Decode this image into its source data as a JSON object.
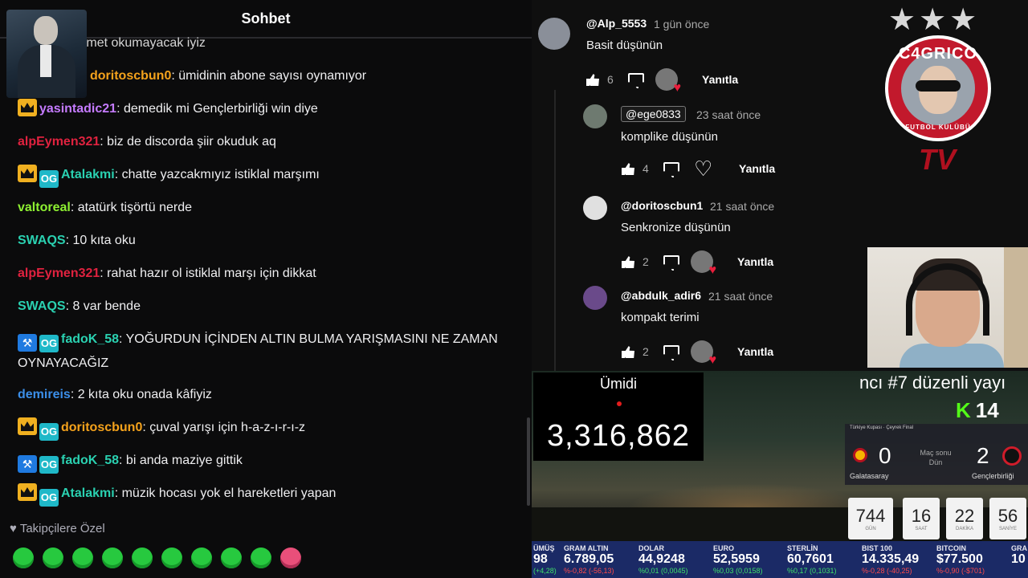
{
  "chat": {
    "title": "Sohbet",
    "messages": [
      {
        "user": "",
        "text": "atatürke rahmet okumayacak iyiz",
        "color": "#d6d6d6"
      },
      {
        "user": "doritoscbun0",
        "text": ": ümidinin abone sayısı oynamıyor",
        "color": "#f4a21c"
      },
      {
        "user": "yasintadic21",
        "text": ": demedik mi Gençlerbirliği win diye",
        "color": "#c57bff"
      },
      {
        "user": "alpEymen321",
        "text": ": biz de discorda şiir okuduk aq",
        "color": "#e0223f"
      },
      {
        "user": "Atalakmi",
        "text": ": chatte yazcakmıyız istiklal marşımı",
        "color": "#2ad1b1"
      },
      {
        "user": "valtoreal",
        "text": ": atatürk tişörtü nerde",
        "color": "#8ef032"
      },
      {
        "user": "SWAQS",
        "text": ": 10 kıta oku",
        "color": "#2ad1b1"
      },
      {
        "user": "alpEymen321",
        "text": ": rahat hazır ol istiklal marşı için dikkat",
        "color": "#e0223f"
      },
      {
        "user": "SWAQS",
        "text": ": 8 var bende",
        "color": "#2ad1b1"
      },
      {
        "user": "fadoK_58",
        "text": ": YOĞURDUN İÇİNDEN ALTIN BULMA YARIŞMASINI NE ZAMAN OYNAYACAĞIZ",
        "color": "#2ad1b1"
      },
      {
        "user": "demireis",
        "text": ": 2 kıta oku onada kâfiyiz",
        "color": "#3b8ee8"
      },
      {
        "user": "doritoscbun0",
        "text": ": çuval yarışı için h-a-z-ı-r-ı-z",
        "color": "#f4a21c"
      },
      {
        "user": "fadoK_58",
        "text": ": bi anda maziye gittik",
        "color": "#2ad1b1"
      },
      {
        "user": "Atalakmi",
        "text": ": müzik hocası yok el hareketleri yapan",
        "color": "#2ad1b1"
      }
    ],
    "followers_only_label": "Takipçilere Özel"
  },
  "comments": [
    {
      "name": "@Alp_5553",
      "time": "1 gün önce",
      "text": "Basit düşünün",
      "likes": "6",
      "reply": "Yanıtla"
    },
    {
      "mention": "@ege0833",
      "time": "23 saat önce",
      "text": "komplike düşünün",
      "likes": "4",
      "reply": "Yanıtla"
    },
    {
      "name": "@doritoscbun1",
      "time": "21 saat önce",
      "text": "Senkronize düşünün",
      "likes": "2",
      "reply": "Yanıtla"
    },
    {
      "name": "@abdulk_adir6",
      "time": "21 saat önce",
      "text": "kompakt terimi",
      "likes": "2",
      "reply": "Yanıtla"
    }
  ],
  "logo": {
    "stars": "★★★",
    "top": "C4GRICO",
    "bottom": "FUTBOL KULÜBÜ",
    "tv": "TV"
  },
  "sub": {
    "label": "Ümidi",
    "count": "3,316,862"
  },
  "marquee": "ncı #7 düzenli yayı",
  "kick": {
    "logo": "K",
    "viewers": "14"
  },
  "score": {
    "header": "Türkiye Kupası · Çeyrek Final",
    "home": {
      "name": "Galatasaray",
      "score": "0"
    },
    "away": {
      "name": "Gençlerbirliği",
      "score": "2"
    },
    "status": "Maç sonu",
    "date": "Dün"
  },
  "countdown": [
    {
      "value": "744",
      "label": "GÜN"
    },
    {
      "value": "16",
      "label": "SAAT"
    },
    {
      "value": "22",
      "label": "DAKİKA"
    },
    {
      "value": "56",
      "label": "SANİYE"
    }
  ],
  "ticker": [
    {
      "name": "ÜMÜŞ",
      "value": "98",
      "change": "(+4,28)",
      "color": "#3fe06a"
    },
    {
      "name": "GRAM ALTIN",
      "value": "6.789,05",
      "change": "%-0,82 (-56,13)",
      "color": "#ff4a4a"
    },
    {
      "name": "DOLAR",
      "value": "44,9248",
      "change": "%0,01 (0,0045)",
      "color": "#3fe06a"
    },
    {
      "name": "EURO",
      "value": "52,5959",
      "change": "%0,03 (0,0158)",
      "color": "#3fe06a"
    },
    {
      "name": "STERLİN",
      "value": "60,7601",
      "change": "%0,17 (0,1031)",
      "color": "#3fe06a"
    },
    {
      "name": "BIST 100",
      "value": "14.335,49",
      "change": "%-0,28 (-40,25)",
      "color": "#ff4a4a"
    },
    {
      "name": "BITCOIN",
      "value": "$77.500",
      "change": "%-0,90 (-$701)",
      "color": "#ff4a4a"
    },
    {
      "name": "GRA",
      "value": "10",
      "change": "",
      "color": "#3fe06a"
    }
  ]
}
